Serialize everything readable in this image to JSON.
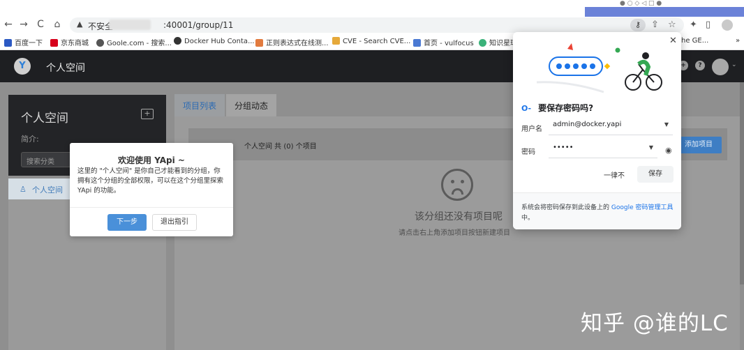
{
  "browser": {
    "insecure_label": "不安全",
    "url_suffix": ":40001/group/11",
    "nav": {
      "back": "←",
      "forward": "→",
      "reload": "C",
      "home": "⌂"
    },
    "bookmarks": [
      {
        "label": "百度一下",
        "color": "#2b59c3"
      },
      {
        "label": "京东商城",
        "color": "#d7001b"
      },
      {
        "label": "Goole.com - 搜索...",
        "color": "#555555"
      },
      {
        "label": "Docker Hub Conta...",
        "color": "#333333"
      },
      {
        "label": "正则表达式在线测...",
        "color": "#e27b3f"
      },
      {
        "label": "CVE - Search CVE...",
        "color": "#e6a93a"
      },
      {
        "label": "首页 - vulfocus",
        "color": "#4a79d3"
      },
      {
        "label": "知识星球",
        "color": "#3bb27a"
      },
      {
        "label": "he GE...",
        "color": "#999999"
      }
    ],
    "more_bookmarks": "»"
  },
  "app": {
    "title": "个人空间",
    "logo_glyph": "Y",
    "accent": "#3e7ec4"
  },
  "sidebar": {
    "group_title": "个人空间",
    "intro_label": "简介:",
    "search_placeholder": "搜索分类",
    "items": [
      {
        "icon": "user-icon",
        "label": "个人空间"
      }
    ]
  },
  "main": {
    "tabs": [
      {
        "label": "项目列表",
        "active": true
      },
      {
        "label": "分组动态",
        "active": false
      }
    ],
    "summary": "个人空间 共 (0) 个项目",
    "add_project_label": "添加项目",
    "empty_title": "该分组还没有项目呢",
    "empty_hint": "请点击右上角添加项目按钮新建项目"
  },
  "guide": {
    "title": "欢迎使用 YApi ~",
    "body": "这里的 \"个人空间\" 是你自己才能看到的分组，你拥有这个分组的全部权限，可以在这个分组里探索 YApi 的功能。",
    "next_label": "下一步",
    "exit_label": "退出指引"
  },
  "password_dialog": {
    "heading": "要保存密码吗?",
    "username_label": "用户名",
    "username_value": "admin@docker.yapi",
    "password_label": "密码",
    "password_value": "•••••",
    "never_label": "一律不",
    "save_label": "保存",
    "footer_text": "系统会将密码保存到此设备上的 ",
    "footer_link": "Google 密码管理工具",
    "footer_end": "中。"
  },
  "watermark": "知乎 @谁的LC"
}
